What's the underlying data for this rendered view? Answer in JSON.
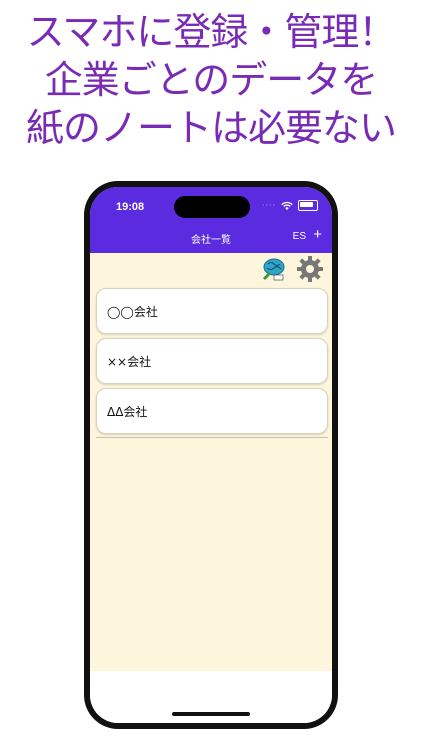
{
  "headline": {
    "line1": "スマホに登録・管理！",
    "line2": "企業ごとのデータを",
    "line3": "紙のノートは必要ない"
  },
  "status_bar": {
    "time": "19:08",
    "dots": "····"
  },
  "navbar": {
    "title": "会社一覧",
    "es_label": "ES",
    "add_label": "+"
  },
  "toolbar": {
    "icons": [
      "brain-icon",
      "gear-icon"
    ]
  },
  "companies": [
    {
      "name": "◯◯会社"
    },
    {
      "name": "××会社"
    },
    {
      "name": "ΔΔ会社"
    }
  ],
  "colors": {
    "navbar": "#5b2be0",
    "headline": "#7a2bb5",
    "background": "#fdf5dc"
  }
}
